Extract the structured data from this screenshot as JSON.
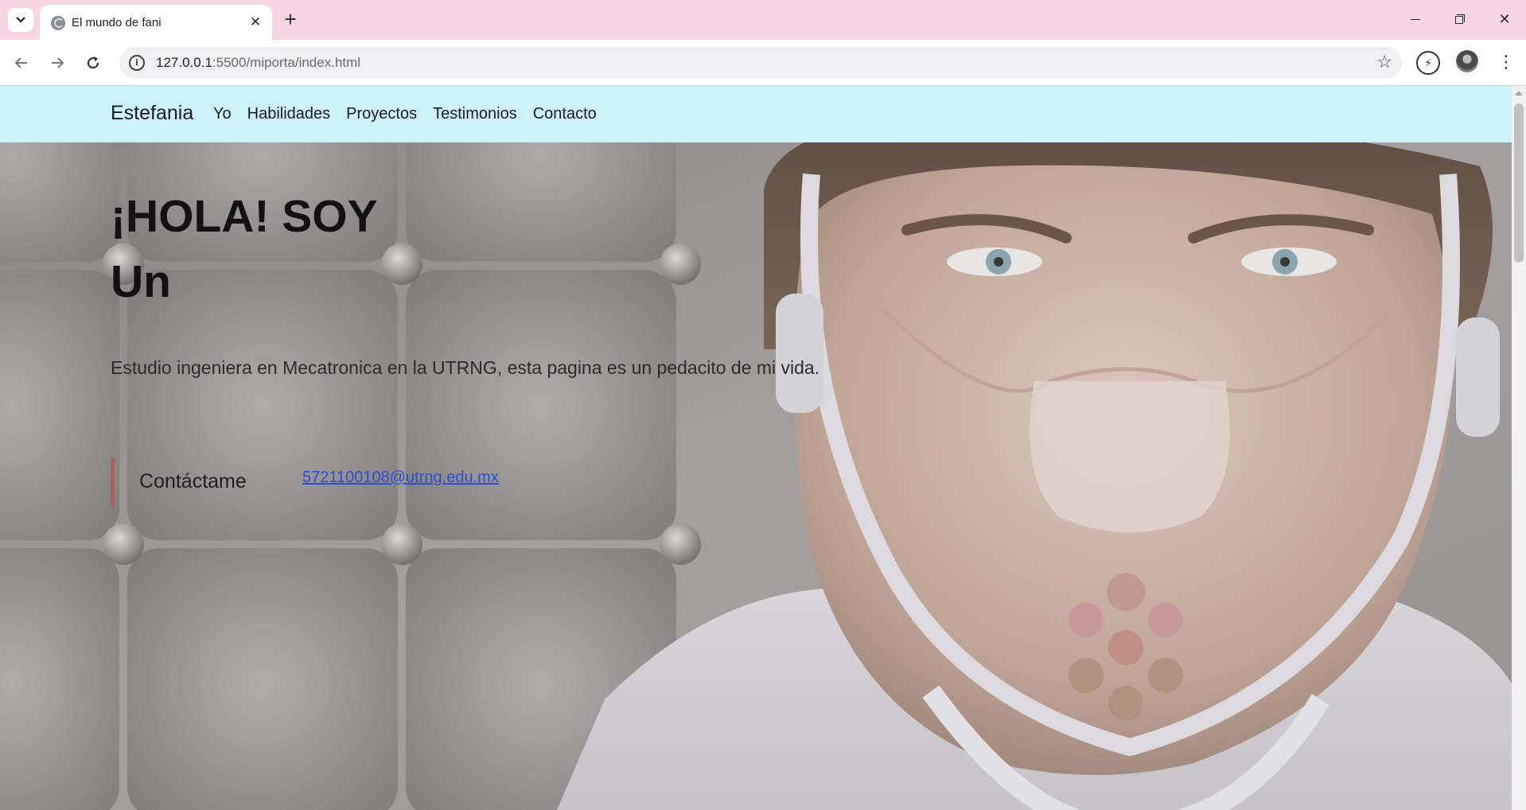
{
  "browser": {
    "tab_title": "El mundo de fani",
    "url_host": "127.0.0.1",
    "url_rest": ":5500/miporta/index.html"
  },
  "site": {
    "brand": "Estefania",
    "nav_links": [
      "Yo",
      "Habilidades",
      "Proyectos",
      "Testimonios",
      "Contacto"
    ],
    "hero": {
      "title": "¡HOLA! SOY",
      "subtitle": "Un",
      "description": "Estudio ingeniera en Mecatronica en la UTRNG, esta pagina es un pedacito de mi vida.",
      "contact_button": "Contáctame",
      "contact_email": "5721100108@utrng.edu.mx"
    }
  },
  "colors": {
    "tabbar_bg": "#f7d5e2",
    "site_nav_bg": "#cdf1f9",
    "accent_bar": "#b65a5a",
    "link": "#2a4fd4"
  }
}
